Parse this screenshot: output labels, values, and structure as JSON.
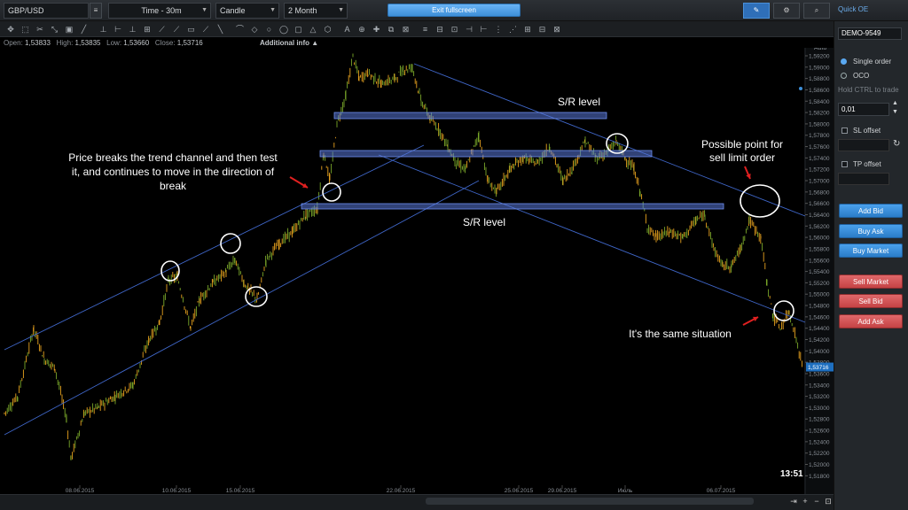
{
  "toolbar": {
    "symbol": "GBP/USD",
    "timeframe": "Time - 30m",
    "chart_type": "Candle",
    "period": "2 Month",
    "exit_fullscreen": "Exit fullscreen",
    "quick_oe": "Quick OE"
  },
  "ohlc": {
    "open_label": "Open:",
    "open": "1,53833",
    "high_label": "High:",
    "high": "1,53835",
    "low_label": "Low:",
    "low": "1,53660",
    "close_label": "Close:",
    "close": "1,53716",
    "additional_info": "Additional info"
  },
  "chart": {
    "axis_mode": "Auto",
    "price_ticks": [
      "1,59200",
      "1,59000",
      "1,58800",
      "1,58600",
      "1,58400",
      "1,58200",
      "1,58000",
      "1,57800",
      "1,57600",
      "1,57400",
      "1,57200",
      "1,57000",
      "1,56800",
      "1,56600",
      "1,56400",
      "1,56200",
      "1,56000",
      "1,55800",
      "1,55600",
      "1,55400",
      "1,55200",
      "1,55000",
      "1,54800",
      "1,54600",
      "1,54400",
      "1,54200",
      "1,54000",
      "1,53800",
      "1,53600",
      "1,53400",
      "1,53200",
      "1,53000",
      "1,52800",
      "1,52600",
      "1,52400",
      "1,52200",
      "1,52000",
      "1,51800"
    ],
    "date_ticks": [
      "08.06.2015",
      "10.06.2015",
      "15.06.2015",
      "22.06.2015",
      "25.06.2015",
      "29.06.2015",
      "Июль",
      "06.07.2015"
    ],
    "current_price": "1,53716",
    "clock": "13:51",
    "annotations": {
      "sr_top": "S/R level",
      "sr_bottom": "S/R level",
      "breakout_line1": "Price breaks the trend channel and then test",
      "breakout_line2": "it, and continues to move in the direction of",
      "breakout_line3": "break",
      "possible_line1": "Possible point for",
      "possible_line2": "sell limit order",
      "same": "It's the same situation"
    },
    "colors": {
      "candle_up": "#e8a21e",
      "candle_down": "#7aa82a",
      "channel": "#3f66c8",
      "sr_band": "#5a78d8"
    }
  },
  "panel": {
    "account": "DEMO-9549",
    "single_order": "Single order",
    "oco": "OCO",
    "hint": "Hold CTRL to trade",
    "quantity": "0,01",
    "sl_offset": "SL offset",
    "tp_offset": "TP offset",
    "add_bid": "Add Bid",
    "buy_ask": "Buy Ask",
    "buy_market": "Buy Market",
    "sell_market": "Sell Market",
    "sell_bid": "Sell Bid",
    "add_ask": "Add Ask"
  }
}
